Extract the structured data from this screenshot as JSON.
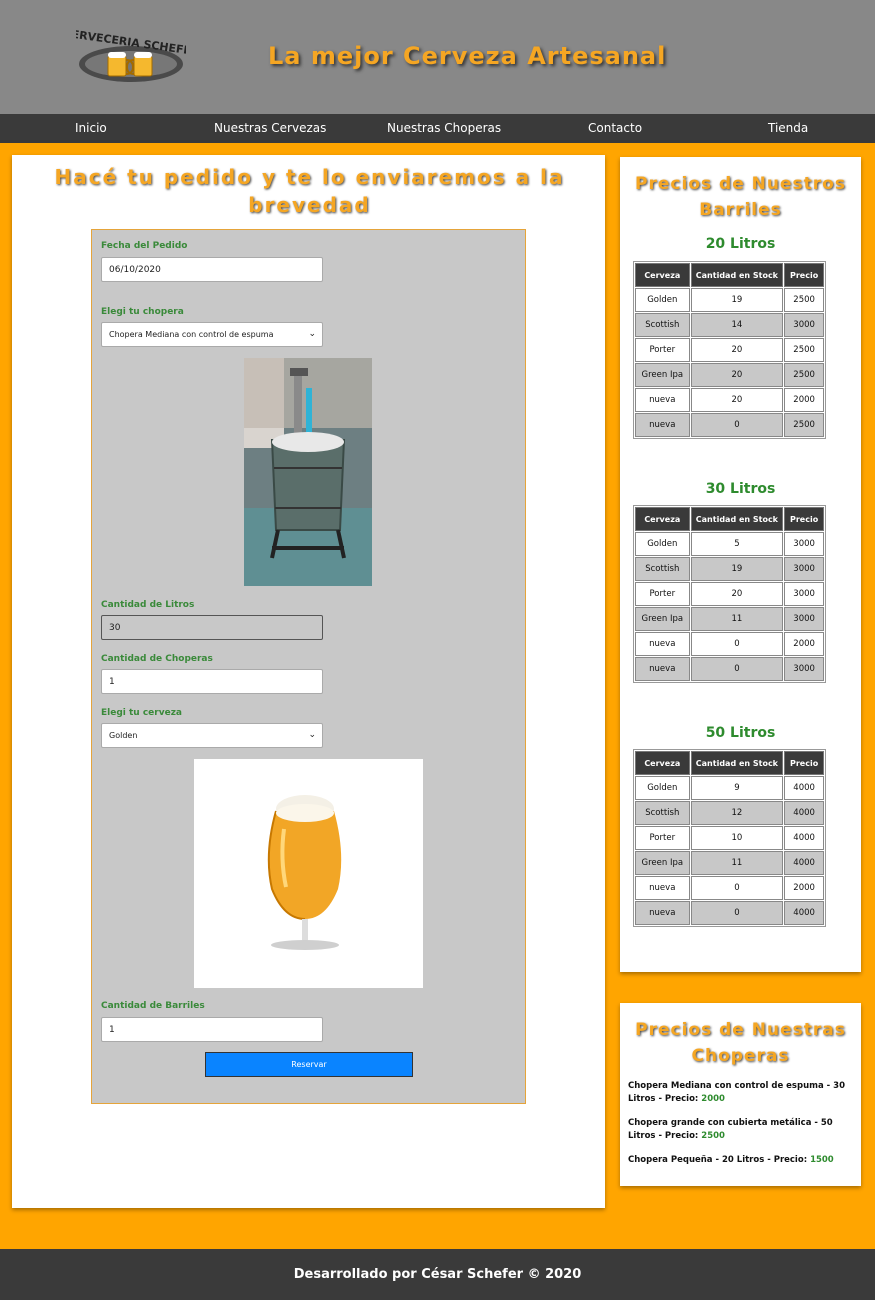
{
  "header": {
    "logo_text": "CERVECERIA SCHEFER",
    "title": "La mejor Cerveza Artesanal"
  },
  "nav": {
    "items": [
      "Inicio",
      "Nuestras Cervezas",
      "Nuestras Choperas",
      "Contacto",
      "Tienda"
    ]
  },
  "order": {
    "heading": "Hacé tu pedido y te lo enviaremos a la brevedad",
    "date_label": "Fecha del Pedido",
    "date_value": "06/10/2020",
    "chopera_label": "Elegi tu chopera",
    "chopera_value": "Chopera Mediana con control de espuma",
    "liters_label": "Cantidad de Litros",
    "liters_value": "30",
    "choperas_qty_label": "Cantidad de Choperas",
    "choperas_qty_value": "1",
    "beer_label": "Elegi tu cerveza",
    "beer_value": "Golden",
    "barrels_label": "Cantidad de Barriles",
    "barrels_value": "1",
    "submit_label": "Reservar"
  },
  "barrels": {
    "heading": "Precios de Nuestros Barriles",
    "columns": [
      "Cerveza",
      "Cantidad en Stock",
      "Precio"
    ],
    "tables": [
      {
        "title": "20 Litros",
        "rows": [
          [
            "Golden",
            "19",
            "2500"
          ],
          [
            "Scottish",
            "14",
            "3000"
          ],
          [
            "Porter",
            "20",
            "2500"
          ],
          [
            "Green Ipa",
            "20",
            "2500"
          ],
          [
            "nueva",
            "20",
            "2000"
          ],
          [
            "nueva",
            "0",
            "2500"
          ]
        ]
      },
      {
        "title": "30 Litros",
        "rows": [
          [
            "Golden",
            "5",
            "3000"
          ],
          [
            "Scottish",
            "19",
            "3000"
          ],
          [
            "Porter",
            "20",
            "3000"
          ],
          [
            "Green Ipa",
            "11",
            "3000"
          ],
          [
            "nueva",
            "0",
            "2000"
          ],
          [
            "nueva",
            "0",
            "3000"
          ]
        ]
      },
      {
        "title": "50 Litros",
        "rows": [
          [
            "Golden",
            "9",
            "4000"
          ],
          [
            "Scottish",
            "12",
            "4000"
          ],
          [
            "Porter",
            "10",
            "4000"
          ],
          [
            "Green Ipa",
            "11",
            "4000"
          ],
          [
            "nueva",
            "0",
            "2000"
          ],
          [
            "nueva",
            "0",
            "4000"
          ]
        ]
      }
    ]
  },
  "choperas": {
    "heading": "Precios de Nuestras Choperas",
    "items": [
      {
        "text": "Chopera Mediana con control de espuma - 30 Litros - Precio: ",
        "price": "2000"
      },
      {
        "text": "Chopera grande con cubierta metálica - 50 Litros - Precio: ",
        "price": "2500"
      },
      {
        "text": "Chopera Pequeña - 20 Litros - Precio: ",
        "price": "1500"
      }
    ]
  },
  "footer": {
    "text": "Desarrollado por César Schefer © 2020"
  },
  "colors": {
    "page_bg": "#FFA500",
    "header_bg": "#888888",
    "nav_bg": "#3a3a3a",
    "accent_title": "#F5A623",
    "label_green": "#2E8B2E",
    "button_blue": "#0A84FF"
  }
}
